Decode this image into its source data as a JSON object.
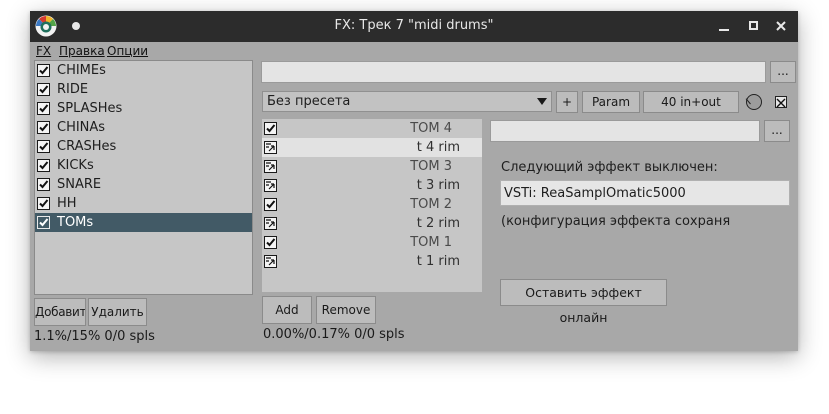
{
  "window": {
    "title": "FX: Трек 7 \"midi drums\"",
    "controls": {
      "minimize": "–",
      "maximize": "□",
      "close": "✕"
    }
  },
  "menu": [
    {
      "label": "FX"
    },
    {
      "label": "Правка"
    },
    {
      "label": "Опции"
    }
  ],
  "fx_chain": {
    "items": [
      {
        "label": "CHIMEs",
        "enabled": true
      },
      {
        "label": "RIDE",
        "enabled": true
      },
      {
        "label": "SPLASHes",
        "enabled": true
      },
      {
        "label": "CHINAs",
        "enabled": true
      },
      {
        "label": "CRASHes",
        "enabled": true
      },
      {
        "label": "KICKs",
        "enabled": true
      },
      {
        "label": "SNARE",
        "enabled": true
      },
      {
        "label": "HH",
        "enabled": true
      },
      {
        "label": "TOMs",
        "enabled": true,
        "selected": true
      }
    ],
    "add_button": "Добавить",
    "remove_button": "Удалить",
    "cpu_status": "1.1%/15% 0/0 spls"
  },
  "plugin": {
    "top_field_value": "",
    "top_field_button": "...",
    "preset": "Без пресета",
    "plus_button": "+",
    "param_button": "Param",
    "io_button": "40 in+out",
    "pins": [
      {
        "label": "TOM 4",
        "type": "group"
      },
      {
        "label": "t 4 rim",
        "type": "item",
        "highlight": true
      },
      {
        "label": "TOM 3",
        "type": "group"
      },
      {
        "label": "t 3 rim",
        "type": "item"
      },
      {
        "label": "TOM 2",
        "type": "group"
      },
      {
        "label": "t 2 rim",
        "type": "item"
      },
      {
        "label": "TOM 1",
        "type": "group"
      },
      {
        "label": "t 1 rim",
        "type": "item"
      }
    ],
    "add_button": "Add",
    "remove_button": "Remove",
    "cpu_status": "0.00%/0.17% 0/0 spls",
    "search_value": "",
    "search_button": "...",
    "next_effect_label": "Следующий эффект выключен:",
    "vsti_name": "VSTi: ReaSamplOmatic5000",
    "config_text": "(конфигурация эффекта сохраня",
    "keep_online_button": "Оставить эффект онлайн"
  },
  "colors": {
    "window_bg": "#a8a8a8",
    "titlebar_bg": "#2c2c2c",
    "selection": "#425a66"
  }
}
